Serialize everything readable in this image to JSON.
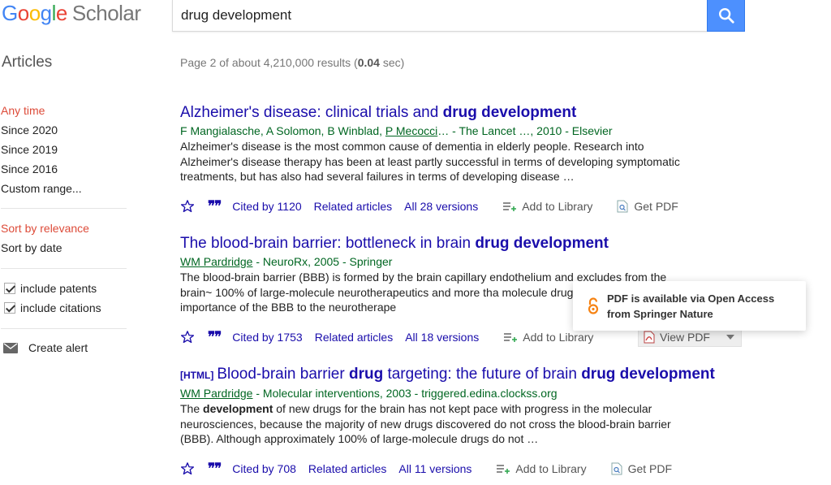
{
  "header": {
    "logo_google": [
      "G",
      "o",
      "o",
      "g",
      "l",
      "e"
    ],
    "logo_scholar": "Scholar",
    "search_value": "drug development",
    "search_button_icon": "search-icon"
  },
  "stats": {
    "prefix": "Page 2 of about 4,210,000 results (",
    "time": "0.04",
    "suffix": " sec)"
  },
  "sidebar": {
    "section_title": "Articles",
    "time_filters": [
      "Any time",
      "Since 2020",
      "Since 2019",
      "Since 2016",
      "Custom range..."
    ],
    "sort_options": [
      "Sort by relevance",
      "Sort by date"
    ],
    "checkboxes": [
      "include patents",
      "include citations"
    ],
    "create_alert": "Create alert"
  },
  "results": [
    {
      "title_plain": "Alzheimer's disease: clinical trials and ",
      "title_bold": "drug development",
      "authors_plain": "F Mangialasche, A Solomon, B Winblad, ",
      "authors_link": "P Mecocci",
      "authors_rest": "… - The Lancet …, 2010 - Elsevier",
      "snippet": "Alzheimer's disease is the most common cause of dementia in elderly people. Research into Alzheimer's disease therapy has been at least partly successful in terms of developing symptomatic treatments, but has also had several failures in terms of developing disease …",
      "cited": "Cited by 1120",
      "related": "Related articles",
      "versions": "All 28 versions",
      "library": "Add to Library",
      "pdf": "Get PDF"
    },
    {
      "title_plain": "The blood-brain barrier: bottleneck in brain ",
      "title_bold": "drug development",
      "authors_link": "WM Pardridge",
      "authors_rest": " - NeuroRx, 2005 - Springer",
      "snippet": "The blood-brain barrier (BBB) is formed by the brain capillary endothelium and excludes from the brain~ 100% of large-molecule neurotherapeutics and more tha molecule drugs. Despite the importance of the BBB to the neurotherape",
      "cited": "Cited by 1753",
      "related": "Related articles",
      "versions": "All 18 versions",
      "library": "Add to Library",
      "pdf": "View PDF"
    },
    {
      "tag": "[HTML]",
      "title_a": "Blood-brain barrier ",
      "title_b": "drug",
      "title_c": " targeting: the future of brain ",
      "title_d": "drug development",
      "authors_link": "WM Pardridge",
      "authors_rest": " - Molecular interventions, 2003 - triggered.edina.clockss.org",
      "snippet_pre": "The ",
      "snippet_bold": "development",
      "snippet_post": " of new drugs for the brain has not kept pace with progress in the molecular neurosciences, because the majority of new drugs discovered do not cross the blood-brain barrier (BBB). Although approximately 100% of large-molecule drugs do not …",
      "cited": "Cited by 708",
      "related": "Related articles",
      "versions": "All 11 versions",
      "library": "Add to Library",
      "pdf": "Get PDF"
    }
  ],
  "popup": {
    "line1": "PDF is available via Open Access",
    "line2": "from Springer Nature",
    "icon": "open-access-icon"
  },
  "colors": {
    "link": "#1a0dab",
    "green": "#006621",
    "active": "#dd4b39",
    "search_button": "#4d90fe"
  }
}
